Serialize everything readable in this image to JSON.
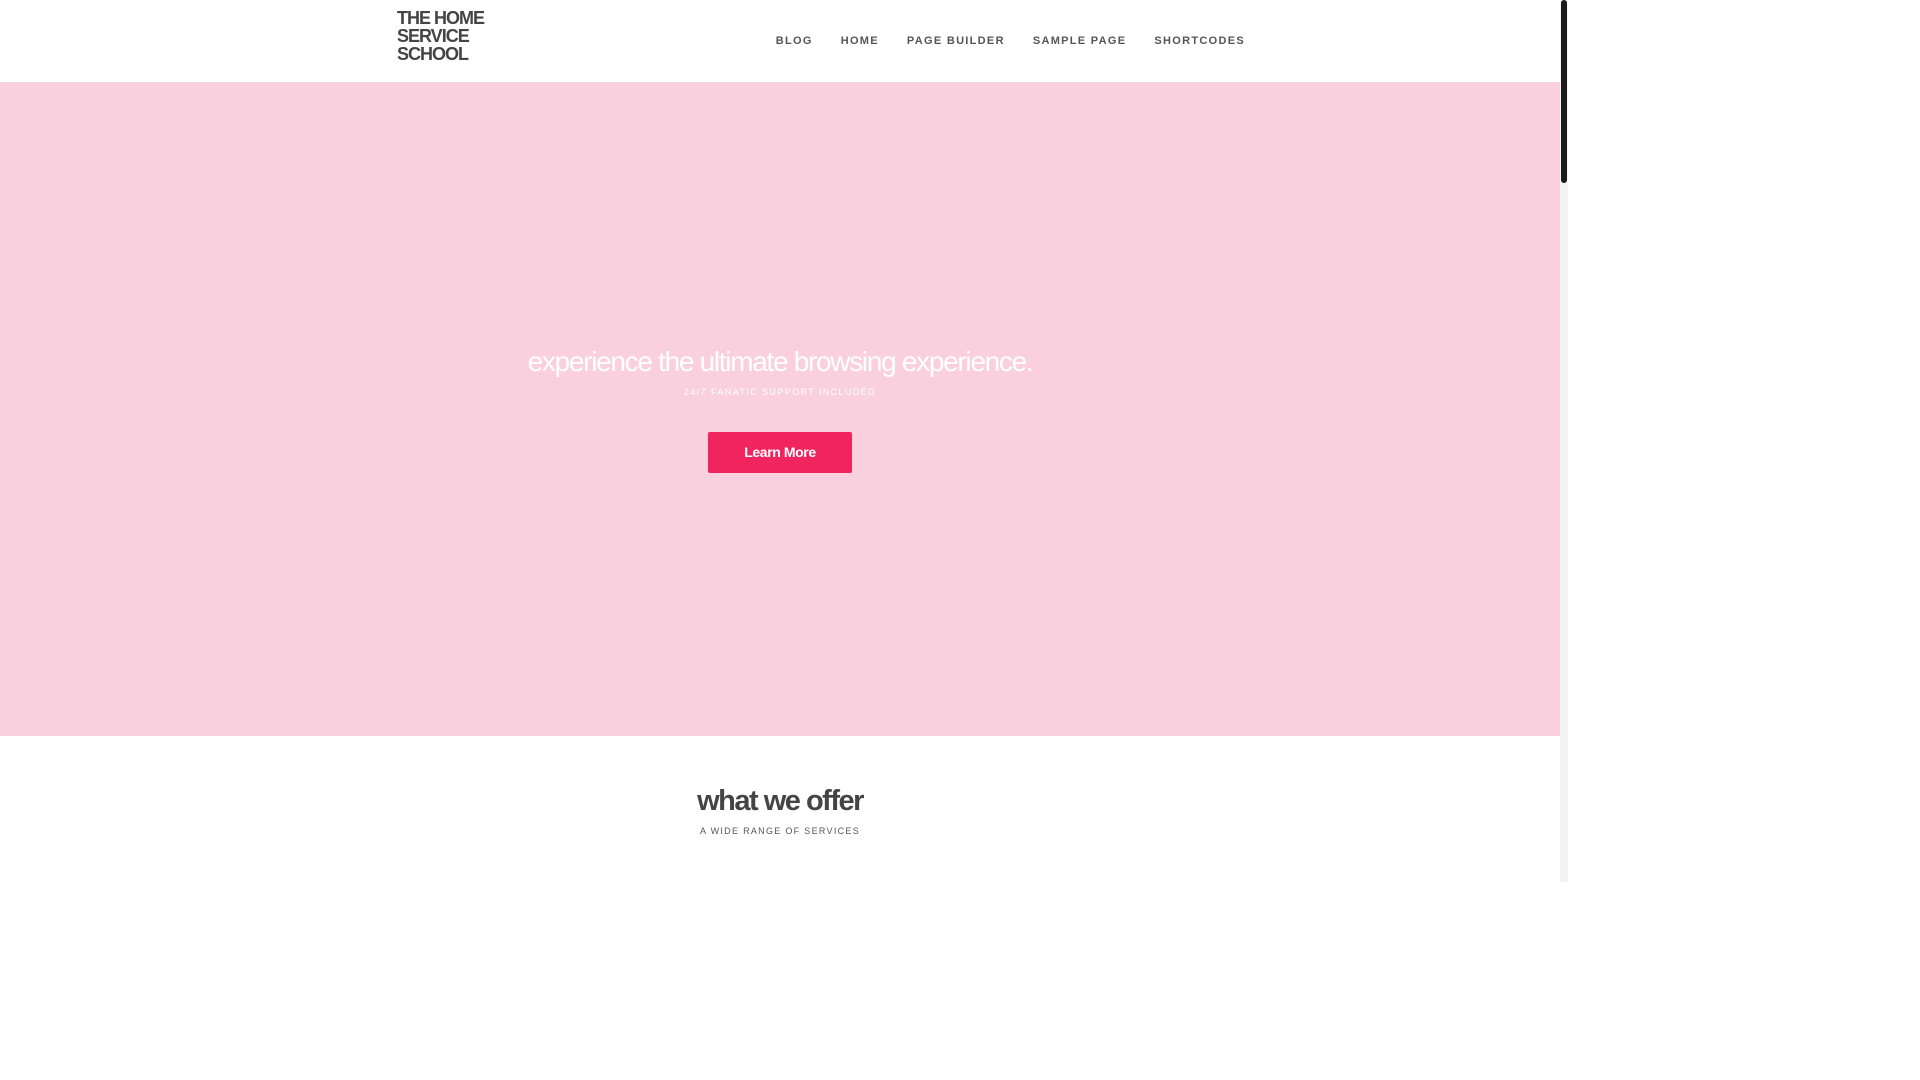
{
  "site": {
    "logo_lines": [
      "THE HOME",
      "SERVICE",
      "SCHOOL"
    ]
  },
  "nav": {
    "items": [
      {
        "label": "BLOG"
      },
      {
        "label": "HOME"
      },
      {
        "label": "PAGE BUILDER"
      },
      {
        "label": "SAMPLE PAGE"
      },
      {
        "label": "SHORTCODES"
      }
    ]
  },
  "hero": {
    "title": "experience the ultimate browsing experience.",
    "subtitle": "24/7 FANATIC SUPPORT INCLUDED",
    "button_label": "Learn More",
    "background_color": "#fad0de",
    "button_color": "#f0245f"
  },
  "offer": {
    "title": "what we offer",
    "subtitle": "A WIDE RANGE OF SERVICES"
  }
}
